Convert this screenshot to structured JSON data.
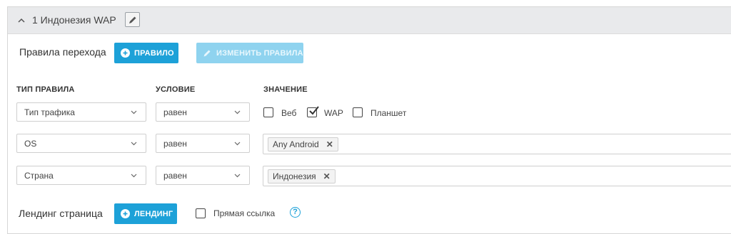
{
  "header": {
    "title": "1 Индонезия WAP"
  },
  "rules_bar": {
    "label": "Правила перехода",
    "add_rule_button": "ПРАВИЛО",
    "change_rules_button": "ИЗМЕНИТЬ ПРАВИЛА"
  },
  "columns": {
    "type": "ТИП ПРАВИЛА",
    "condition": "УСЛОВИЕ",
    "value": "ЗНАЧЕНИЕ"
  },
  "rules": [
    {
      "type": "Тип трафика",
      "condition": "равен",
      "checkboxes": [
        {
          "label": "Веб",
          "checked": false
        },
        {
          "label": "WAP",
          "checked": true
        },
        {
          "label": "Планшет",
          "checked": false
        }
      ]
    },
    {
      "type": "OS",
      "condition": "равен",
      "tag": "Any Android"
    },
    {
      "type": "Страна",
      "condition": "равен",
      "tag": "Индонезия"
    }
  ],
  "landing": {
    "label": "Лендинг страница",
    "button": "ЛЕНДИНГ",
    "direct_link_label": "Прямая ссылка",
    "direct_link_checked": false,
    "help": "?"
  },
  "colors": {
    "accent": "#1da1d8",
    "accent_disabled": "#8fd3ef",
    "header_bg": "#e9eaec"
  },
  "icons": [
    "chevron-up-icon",
    "pencil-icon",
    "plus-circle-icon",
    "chevron-down-icon",
    "checkmark-icon",
    "remove-x-icon",
    "help-icon"
  ]
}
